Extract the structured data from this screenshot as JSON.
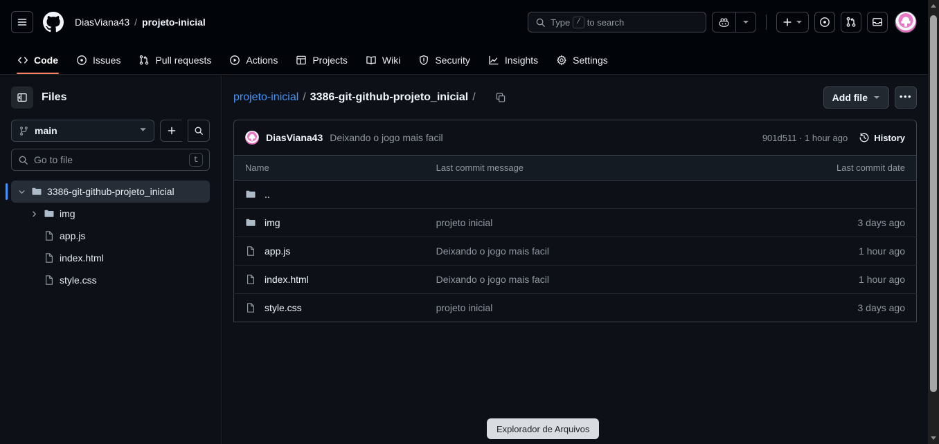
{
  "header": {
    "menu_icon": "hamburger-icon",
    "logo_icon": "github-logo-icon",
    "owner": "DiasViana43",
    "separator": "/",
    "repo": "projeto-inicial",
    "search": {
      "placeholder_prefix": "Type",
      "key": "/",
      "placeholder_suffix": "to search"
    },
    "copilot_icon": "copilot-icon",
    "create_new_icon": "plus-icon",
    "issues_icon": "issue-opened-icon",
    "pull_requests_icon": "git-pull-request-icon",
    "inbox_icon": "inbox-icon",
    "avatar_icon": "user-avatar"
  },
  "nav": {
    "tabs": [
      {
        "label": "Code",
        "icon": "code-icon",
        "active": true
      },
      {
        "label": "Issues",
        "icon": "issue-opened-icon",
        "active": false
      },
      {
        "label": "Pull requests",
        "icon": "git-pull-request-icon",
        "active": false
      },
      {
        "label": "Actions",
        "icon": "play-icon",
        "active": false
      },
      {
        "label": "Projects",
        "icon": "table-icon",
        "active": false
      },
      {
        "label": "Wiki",
        "icon": "book-icon",
        "active": false
      },
      {
        "label": "Security",
        "icon": "shield-icon",
        "active": false
      },
      {
        "label": "Insights",
        "icon": "graph-icon",
        "active": false
      },
      {
        "label": "Settings",
        "icon": "gear-icon",
        "active": false
      }
    ],
    "active_underline_color": "#f78166"
  },
  "sidebar": {
    "title": "Files",
    "toggle_icon": "sidebar-collapse-icon",
    "branch": {
      "name": "main",
      "icon": "git-branch-icon",
      "caret": "chevron-down-icon"
    },
    "add_icon": "plus-icon",
    "search_icon": "search-icon",
    "go_to_file": {
      "placeholder": "Go to file",
      "shortcut": "t",
      "icon": "search-icon"
    },
    "tree": [
      {
        "label": "3386-git-github-projeto_inicial",
        "type": "folder",
        "expanded": true,
        "selected": true,
        "indent": 0
      },
      {
        "label": "img",
        "type": "folder",
        "expanded": false,
        "selected": false,
        "indent": 1
      },
      {
        "label": "app.js",
        "type": "file",
        "selected": false,
        "indent": 1
      },
      {
        "label": "index.html",
        "type": "file",
        "selected": false,
        "indent": 1
      },
      {
        "label": "style.css",
        "type": "file",
        "selected": false,
        "indent": 1
      }
    ]
  },
  "main": {
    "breadcrumb": {
      "root": "projeto-inicial",
      "sep1": "/",
      "current": "3386-git-github-projeto_inicial",
      "sep2": "/",
      "copy_icon": "copy-path-icon"
    },
    "add_file_label": "Add file",
    "add_file_caret": "chevron-down-icon",
    "kebab_label": "•••",
    "commit": {
      "author": "DiasViana43",
      "message": "Deixando o jogo mais facil",
      "hash_and_time": "901d511 · 1 hour ago",
      "history_label": "History",
      "history_icon": "history-clock-icon"
    },
    "table": {
      "columns": {
        "name": "Name",
        "message": "Last commit message",
        "date": "Last commit date"
      },
      "rows": [
        {
          "name": "..",
          "type": "folder",
          "message": "",
          "date": ""
        },
        {
          "name": "img",
          "type": "folder",
          "message": "projeto inicial",
          "date": "3 days ago"
        },
        {
          "name": "app.js",
          "type": "file",
          "message": "Deixando o jogo mais facil",
          "date": "1 hour ago"
        },
        {
          "name": "index.html",
          "type": "file",
          "message": "Deixando o jogo mais facil",
          "date": "1 hour ago"
        },
        {
          "name": "style.css",
          "type": "file",
          "message": "projeto inicial",
          "date": "3 days ago"
        }
      ]
    }
  },
  "tooltip": {
    "text": "Explorador de Arquivos"
  },
  "scrollbar": {
    "up_icon": "scroll-up-arrow",
    "down_icon": "scroll-down-arrow"
  },
  "colors": {
    "background": "#0d1117",
    "header_bg": "#010409",
    "accent": "#f78166",
    "link": "#4493f8",
    "border": "#3d444d",
    "muted_text": "#9198a1"
  }
}
